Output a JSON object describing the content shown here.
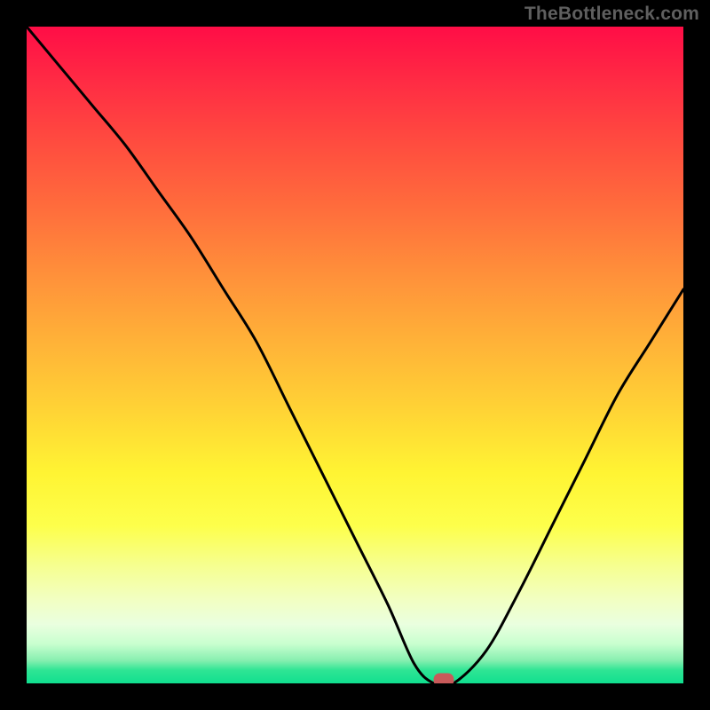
{
  "watermark": "TheBottleneck.com",
  "chart_data": {
    "type": "line",
    "title": "",
    "xlabel": "",
    "ylabel": "",
    "xlim": [
      0,
      100
    ],
    "ylim": [
      0,
      100
    ],
    "grid": false,
    "series": [
      {
        "name": "curve",
        "x": [
          0,
          5,
          10,
          15,
          20,
          25,
          30,
          35,
          40,
          45,
          50,
          55,
          59,
          62,
          65,
          70,
          75,
          80,
          85,
          90,
          95,
          100
        ],
        "y": [
          100,
          94,
          88,
          82,
          75,
          68,
          60,
          52,
          42,
          32,
          22,
          12,
          3,
          0,
          0,
          5,
          14,
          24,
          34,
          44,
          52,
          60
        ]
      }
    ],
    "marker": {
      "x": 63.5,
      "y": 0,
      "color": "#c85a5a"
    },
    "background_gradient": {
      "stops": [
        {
          "pos": 0.0,
          "color": "#ff0d46"
        },
        {
          "pos": 0.18,
          "color": "#ff4d3f"
        },
        {
          "pos": 0.38,
          "color": "#ff913a"
        },
        {
          "pos": 0.58,
          "color": "#ffd235"
        },
        {
          "pos": 0.76,
          "color": "#fdff4b"
        },
        {
          "pos": 0.91,
          "color": "#eaffdf"
        },
        {
          "pos": 1.0,
          "color": "#10df8f"
        }
      ]
    }
  }
}
